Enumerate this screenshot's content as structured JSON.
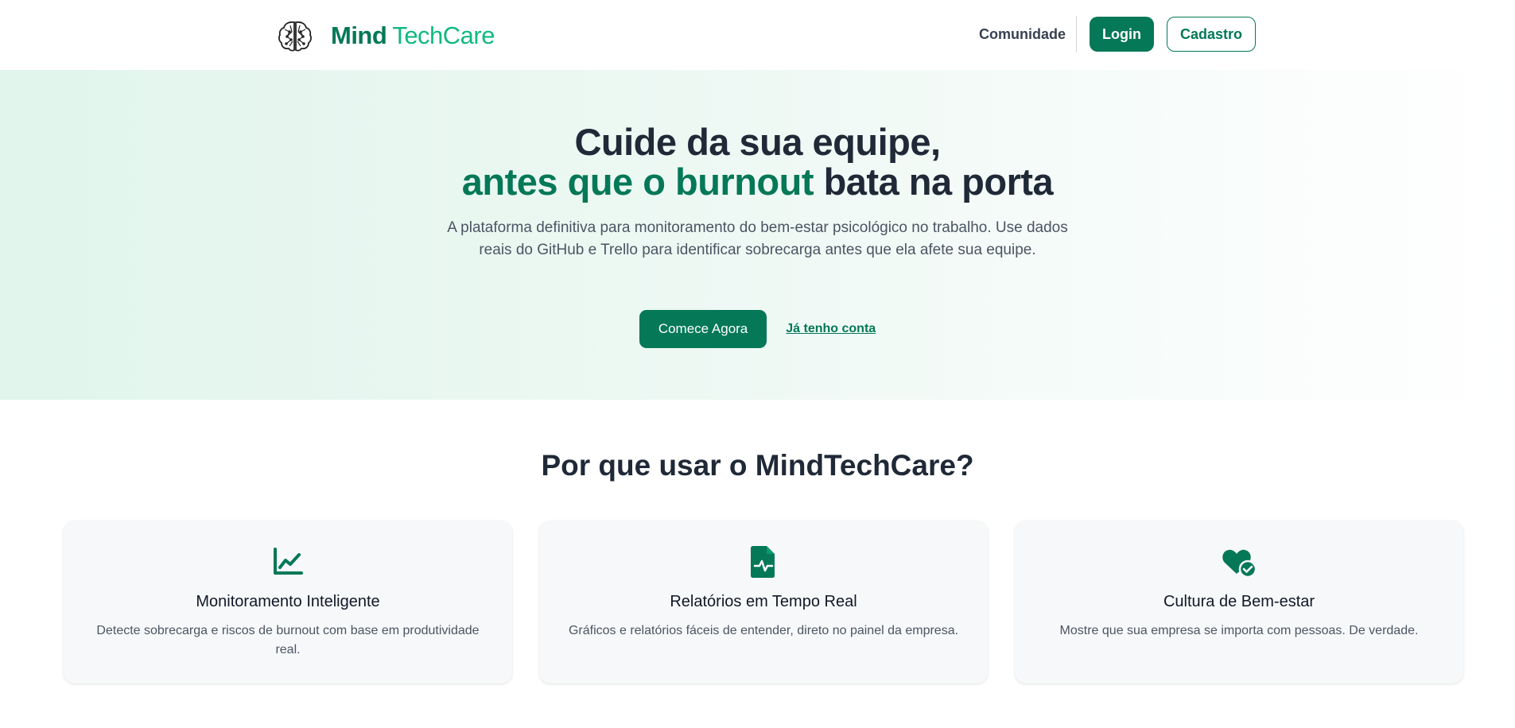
{
  "header": {
    "brand_part1": "Mind",
    "brand_part2": "TechCare",
    "nav_community": "Comunidade",
    "login_label": "Login",
    "signup_label": "Cadastro"
  },
  "hero": {
    "title_line1": "Cuide da sua equipe,",
    "title_accent": "antes que o burnout",
    "title_rest": " bata na porta",
    "description": "A plataforma definitiva para monitoramento do bem-estar psicológico no trabalho. Use dados reais do GitHub e Trello para identificar sobrecarga antes que ela afete sua equipe.",
    "cta_primary": "Comece Agora",
    "cta_secondary": "Já tenho conta"
  },
  "features": {
    "title": "Por que usar o MindTechCare?",
    "items": [
      {
        "icon": "chart-line-icon",
        "title": "Monitoramento Inteligente",
        "description": "Detecte sobrecarga e riscos de burnout com base em produtividade real."
      },
      {
        "icon": "file-medical-icon",
        "title": "Relatórios em Tempo Real",
        "description": "Gráficos e relatórios fáceis de entender, direto no painel da empresa."
      },
      {
        "icon": "heart-check-icon",
        "title": "Cultura de Bem-estar",
        "description": "Mostre que sua empresa se importa com pessoas. De verdade."
      }
    ]
  },
  "colors": {
    "primary": "#047857",
    "accent": "#10b981",
    "text_dark": "#1f2937",
    "text_muted": "#4b5563"
  }
}
